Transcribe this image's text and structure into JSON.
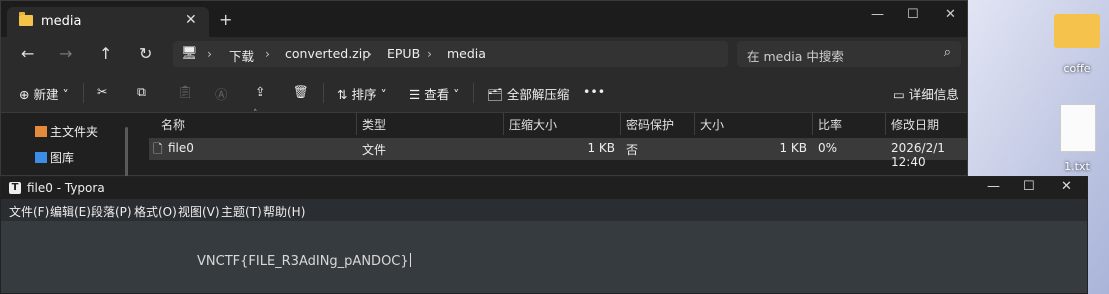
{
  "explorer": {
    "tab_title": "media",
    "tab_close": "✕",
    "new_tab": "+",
    "win_min": "—",
    "win_max": "☐",
    "win_close": "✕",
    "nav": {
      "back": "←",
      "forward": "→",
      "up": "↑",
      "refresh": "↻"
    },
    "breadcrumb": [
      "下载",
      "converted.zip",
      "EPUB",
      "media"
    ],
    "search_placeholder": "在 media 中搜索",
    "toolbar": {
      "new_label": "新建",
      "sort_label": "排序",
      "view_label": "查看",
      "extract_all_label": "全部解压缩",
      "more_label": "•••",
      "details_label": "详细信息"
    },
    "sidebar": [
      {
        "label": "主文件夹",
        "icon": "home-icon"
      },
      {
        "label": "图库",
        "icon": "gallery-icon"
      }
    ],
    "columns": [
      "名称",
      "类型",
      "压缩大小",
      "密码保护",
      "大小",
      "比率",
      "修改日期"
    ],
    "rows": [
      {
        "name": "file0",
        "type": "文件",
        "compressed": "1 KB",
        "password": "否",
        "size": "1 KB",
        "ratio": "0%",
        "modified": "2026/2/1 12:40"
      }
    ]
  },
  "typora": {
    "title": "file0 - Typora",
    "logo": "T",
    "menu": [
      "文件(F)",
      "编辑(E)",
      "段落(P)",
      "格式(O)",
      "视图(V)",
      "主题(T)",
      "帮助(H)"
    ],
    "content": "VNCTF{FILE_R3AdINg_pANDOC}",
    "win_min": "—",
    "win_max": "☐",
    "win_close": "✕"
  },
  "desktop": {
    "icons": [
      {
        "label": "coffe",
        "icon": "folder-icon"
      },
      {
        "label": "1.txt",
        "icon": "text-file-icon"
      }
    ]
  }
}
